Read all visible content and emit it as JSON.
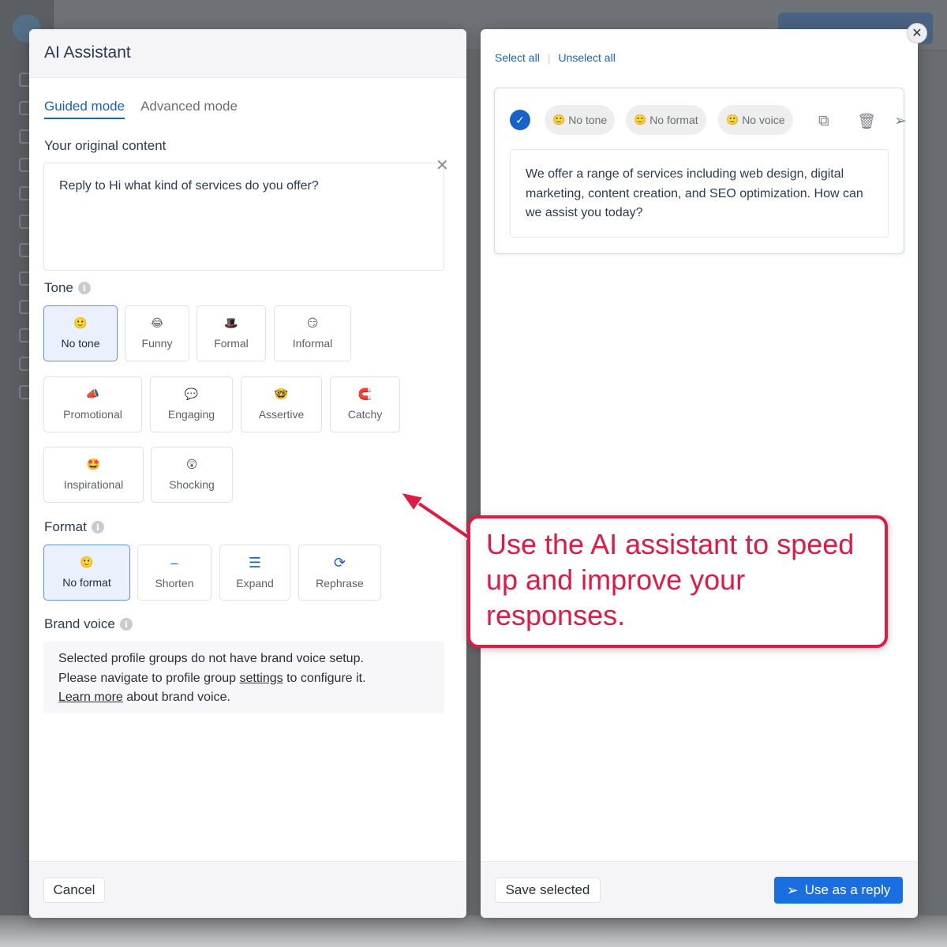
{
  "dialog": {
    "title": "AI Assistant",
    "tabs": [
      {
        "label": "Guided mode",
        "active": true
      },
      {
        "label": "Advanced mode",
        "active": false
      }
    ],
    "original_content": {
      "label": "Your original content",
      "value": "Reply to Hi what kind of services do you offer?",
      "clear_icon": "close-icon"
    },
    "tone": {
      "label": "Tone",
      "info_icon": "i",
      "options": [
        {
          "label": "No tone",
          "emoji": "🙂",
          "selected": true
        },
        {
          "label": "Funny",
          "emoji": "😂",
          "selected": false
        },
        {
          "label": "Formal",
          "emoji": "🎩",
          "selected": false
        },
        {
          "label": "Informal",
          "emoji": "😏",
          "selected": false
        },
        {
          "label": "Promotional",
          "emoji": "📣",
          "selected": false
        },
        {
          "label": "Engaging",
          "emoji": "💬",
          "selected": false
        },
        {
          "label": "Assertive",
          "emoji": "🤓",
          "selected": false
        },
        {
          "label": "Catchy",
          "emoji": "🧲",
          "selected": false
        },
        {
          "label": "Inspirational",
          "emoji": "🤩",
          "selected": false
        },
        {
          "label": "Shocking",
          "emoji": "😲",
          "selected": false
        }
      ]
    },
    "format": {
      "label": "Format",
      "info_icon": "i",
      "options": [
        {
          "label": "No format",
          "icon": "🙂",
          "selected": true
        },
        {
          "label": "Shorten",
          "icon": "⎯",
          "selected": false
        },
        {
          "label": "Expand",
          "icon": "☰",
          "selected": false
        },
        {
          "label": "Rephrase",
          "icon": "⟳",
          "selected": false
        }
      ]
    },
    "brand_voice": {
      "label": "Brand voice",
      "info_icon": "i",
      "line1": "Selected profile groups do not have brand voice setup.",
      "line2_pre": "Please navigate to profile group ",
      "line2_link": "settings",
      "line2_post": " to configure it.",
      "line3_link": "Learn more",
      "line3_post": " about brand voice."
    },
    "cancel_label": "Cancel"
  },
  "results": {
    "select_all": "Select all",
    "unselect_all": "Unselect all",
    "separator": "|",
    "card": {
      "chips": [
        {
          "emoji": "🙂",
          "label": "No tone"
        },
        {
          "emoji": "🙂",
          "label": "No format"
        },
        {
          "emoji": "🙂",
          "label": "No voice"
        }
      ],
      "text": "We offer a range of services including web design, digital marketing, content creation, and SEO optimization. How can we assist you today?",
      "icons": {
        "copy": "copy-icon",
        "delete": "trash-icon",
        "send": "send-icon"
      }
    },
    "save_selected_label": "Save selected",
    "use_as_reply_label": "Use as a reply"
  },
  "annotation": {
    "text": "Use the AI assistant to speed up and improve your responses."
  },
  "colors": {
    "accent": "#1762c9",
    "annotation": "#e11a43"
  }
}
